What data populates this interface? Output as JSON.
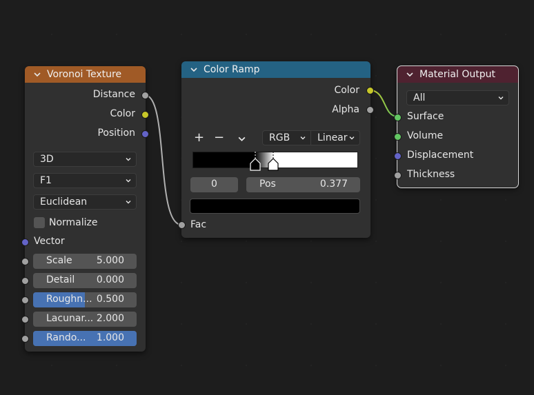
{
  "colors": {
    "background": "#1d1d1d",
    "node_body": "#303030",
    "texture_header": "#a05a26",
    "converter_header": "#246283",
    "output_header": "#4f2230",
    "slider_fill": "#4772b3",
    "field": "#545454",
    "socket_float": "#a1a1a1",
    "socket_color": "#c7c729",
    "socket_vector": "#6363c7",
    "socket_shader": "#63c763"
  },
  "voronoi": {
    "title": "Voronoi Texture",
    "outputs": [
      "Distance",
      "Color",
      "Position"
    ],
    "dimensions": "3D",
    "feature": "F1",
    "metric": "Euclidean",
    "normalize_label": "Normalize",
    "normalize_checked": false,
    "vector_label": "Vector",
    "inputs": [
      {
        "name": "Scale",
        "value": "5.000",
        "fill": 0
      },
      {
        "name": "Detail",
        "value": "0.000",
        "fill": 0
      },
      {
        "name": "Roughn...",
        "value": "0.500",
        "fill": 0.5
      },
      {
        "name": "Lacunar...",
        "value": "2.000",
        "fill": 0
      },
      {
        "name": "Rando...",
        "value": "1.000",
        "fill": 1.0
      }
    ]
  },
  "color_ramp": {
    "title": "Color Ramp",
    "outputs": [
      "Color",
      "Alpha"
    ],
    "add_icon": "+",
    "remove_icon": "−",
    "color_mode": "RGB",
    "interpolation": "Linear",
    "stops": [
      0.377,
      0.49
    ],
    "active_index": "0",
    "pos_label": "Pos",
    "pos_value": "0.377",
    "active_color": "#000000",
    "input_label": "Fac"
  },
  "material_output": {
    "title": "Material Output",
    "target": "All",
    "inputs": [
      "Surface",
      "Volume",
      "Displacement",
      "Thickness"
    ]
  }
}
